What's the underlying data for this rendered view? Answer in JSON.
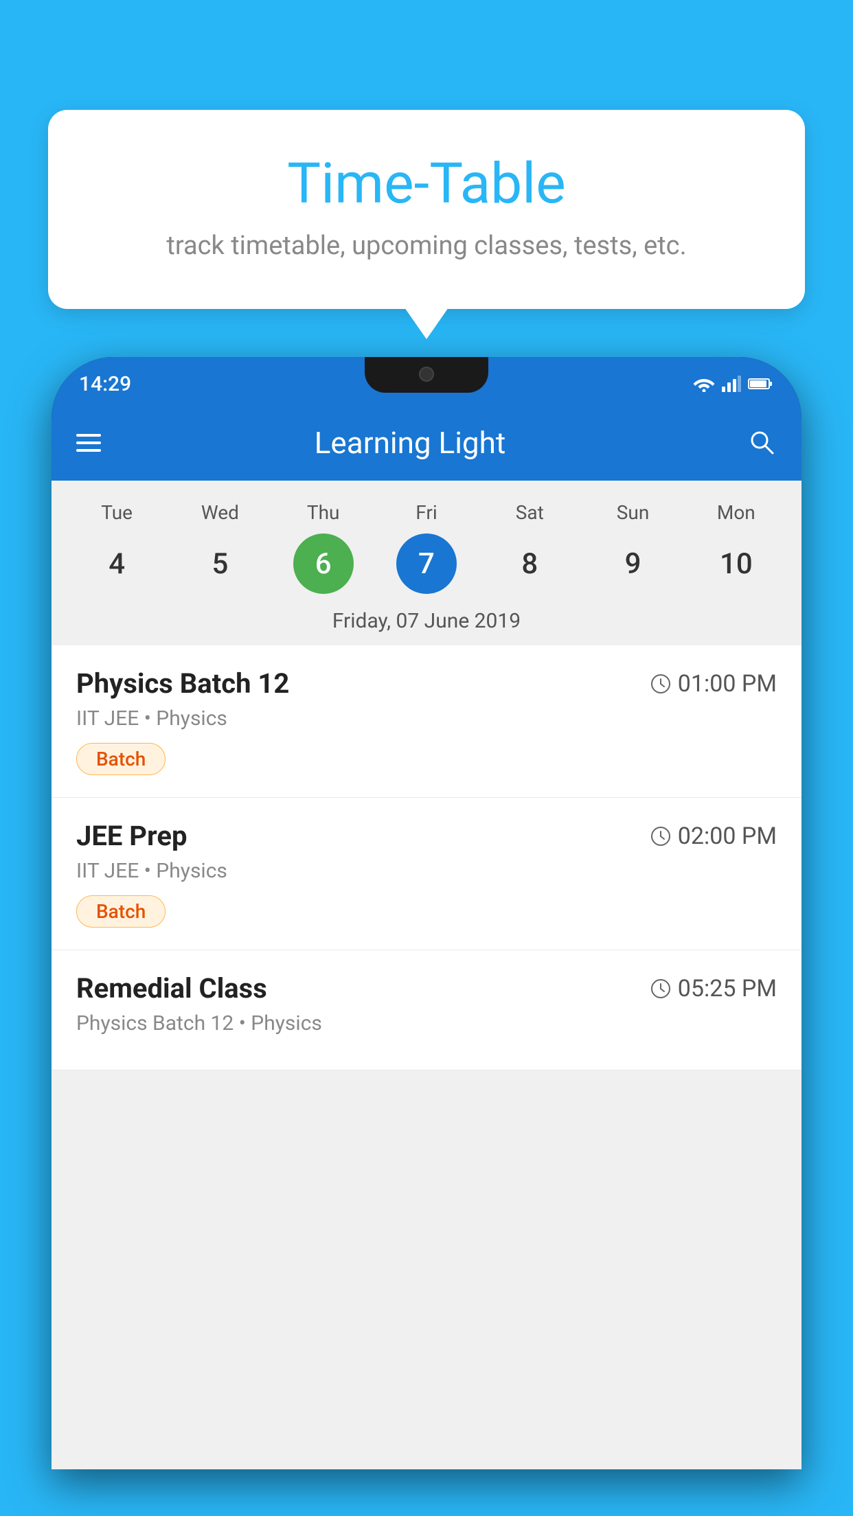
{
  "background_color": "#29B6F6",
  "tooltip": {
    "title": "Time-Table",
    "subtitle": "track timetable, upcoming classes, tests, etc."
  },
  "phone": {
    "status_bar": {
      "time": "14:29"
    },
    "app_bar": {
      "title": "Learning Light"
    },
    "calendar": {
      "days": [
        {
          "label": "Tue",
          "number": "4"
        },
        {
          "label": "Wed",
          "number": "5"
        },
        {
          "label": "Thu",
          "number": "6",
          "state": "today"
        },
        {
          "label": "Fri",
          "number": "7",
          "state": "selected"
        },
        {
          "label": "Sat",
          "number": "8"
        },
        {
          "label": "Sun",
          "number": "9"
        },
        {
          "label": "Mon",
          "number": "10"
        }
      ],
      "selected_date": "Friday, 07 June 2019"
    },
    "classes": [
      {
        "name": "Physics Batch 12",
        "time": "01:00 PM",
        "meta": "IIT JEE • Physics",
        "badge": "Batch"
      },
      {
        "name": "JEE Prep",
        "time": "02:00 PM",
        "meta": "IIT JEE • Physics",
        "badge": "Batch"
      },
      {
        "name": "Remedial Class",
        "time": "05:25 PM",
        "meta": "Physics Batch 12 • Physics",
        "badge": null
      }
    ]
  }
}
